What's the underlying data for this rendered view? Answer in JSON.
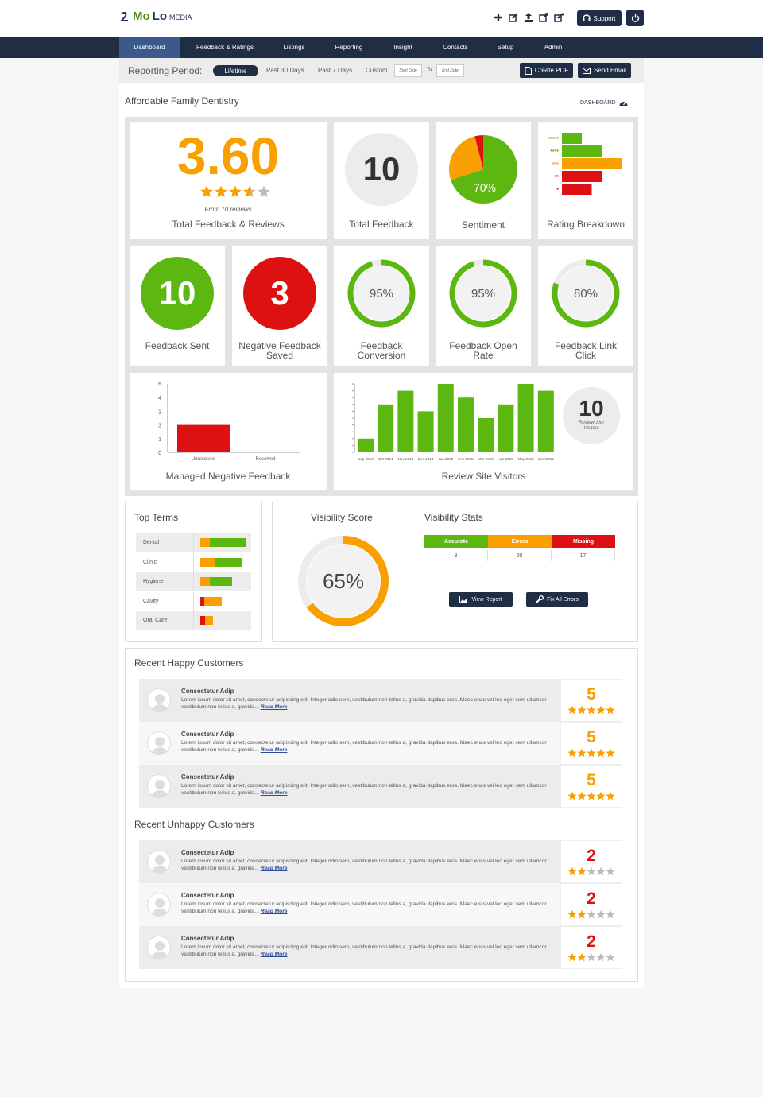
{
  "brand": {
    "mo": "Mo",
    "lo": "Lo",
    "media": "MEDIA"
  },
  "header": {
    "support_label": "Support",
    "icons": [
      "plus-icon",
      "edit-icon",
      "upload-icon",
      "share-icon",
      "external-icon"
    ]
  },
  "nav": {
    "tabs": [
      "Dashboard",
      "Feedback & Ratings",
      "Listings",
      "Reporting",
      "Insight",
      "Contacts",
      "Setup",
      "Admin"
    ],
    "active": "Dashboard"
  },
  "period": {
    "label": "Reporting Period:",
    "selected": "Lifetime",
    "options": [
      "Past 30 Days",
      "Past 7 Days",
      "Custom"
    ],
    "start_placeholder": "Start Date",
    "to": "To",
    "end_placeholder": "End Date",
    "create_pdf": "Create PDF",
    "send_email": "Send Email"
  },
  "business": {
    "name": "Affordable Family Dentistry",
    "dashboard_label": "DASHBOARD"
  },
  "stats": {
    "rating": {
      "value": "3.60",
      "stars": 3.6,
      "sub": "From 10 reviews",
      "caption": "Total Feedback & Reviews"
    },
    "total_feedback": {
      "value": "10",
      "caption": "Total Feedback"
    },
    "sentiment": {
      "value": "70%",
      "caption": "Sentiment",
      "positive": 0.7,
      "negative": 0.04
    },
    "rating_breakdown": {
      "caption": "Rating Breakdown",
      "labels": [
        "*****",
        "****",
        "***",
        "**",
        "*"
      ],
      "values": [
        2,
        4,
        6,
        4,
        3
      ],
      "colors": [
        "#5cb811",
        "#5cb811",
        "#f9a000",
        "#dd1111",
        "#dd1111"
      ]
    },
    "feedback_sent": {
      "value": "10",
      "caption": "Feedback Sent",
      "color": "#5cb811"
    },
    "negative_saved": {
      "value": "3",
      "caption": "Negative Feedback Saved",
      "color": "#dd1111"
    },
    "conversion": {
      "value": "95%",
      "fraction": 0.95,
      "caption": "Feedback Conversion"
    },
    "open_rate": {
      "value": "95%",
      "fraction": 0.95,
      "caption": "Feedback Open Rate"
    },
    "link_click": {
      "value": "80%",
      "fraction": 0.8,
      "caption": "Feedback Link Click"
    },
    "managed_negative": {
      "caption": "Managed Negative Feedback"
    },
    "site_visitors": {
      "caption": "Review Site Visitors",
      "value": "10",
      "sub": "Review Site Visitors"
    }
  },
  "chart_data": [
    {
      "type": "bar",
      "title": "Managed Negative Feedback",
      "categories": [
        "Unresolved",
        "Resolved"
      ],
      "values": [
        2,
        0.05
      ],
      "ytick_labels": [
        "5",
        "4",
        "2",
        "3",
        "1",
        "0"
      ],
      "ylim": [
        0,
        5
      ],
      "colors": [
        "#dd1111",
        "#5cb811"
      ]
    },
    {
      "type": "bar",
      "title": "Review Site Visitors",
      "categories": [
        "Sep 2014",
        "Oct 2014",
        "Nov 2014",
        "Dec 2014",
        "Jan 2015",
        "Feb 2015",
        "Mar 2015",
        "Apr 2015",
        "May 2015",
        "June2015"
      ],
      "values": [
        2,
        7,
        9,
        6,
        10,
        8,
        5,
        7,
        10,
        9
      ],
      "colors": [
        "#5cb811"
      ]
    }
  ],
  "top_terms": {
    "title": "Top Terms",
    "items": [
      {
        "name": "Dental",
        "orange": 12,
        "green": 45
      },
      {
        "name": "Clinic",
        "orange": 18,
        "green": 34
      },
      {
        "name": "Hygiene",
        "orange": 12,
        "green": 28
      },
      {
        "name": "Cavity",
        "red": 5,
        "orange": 22
      },
      {
        "name": "Oral Care",
        "red": 6,
        "orange": 10
      }
    ]
  },
  "visibility": {
    "score_title": "Visibility Score",
    "score": "65%",
    "fraction": 0.65,
    "stats_title": "Visibility Stats",
    "headers": [
      "Accurate",
      "Errors",
      "Missing"
    ],
    "values": [
      "3",
      "20",
      "17"
    ],
    "header_colors": [
      "#5cb811",
      "#f9a000",
      "#dd1111"
    ],
    "view_report": "View Report",
    "fix_errors": "Fix All Errors"
  },
  "happy": {
    "title": "Recent Happy Customers",
    "items": [
      {
        "name": "Consectetur Adip",
        "text": "Lorem ipsum dolor sit amet, consectetur adipiscing elit. Integer odio sem, vestibulum non tellus a, gravida dapibus eros. Maec enas vel leo eget sem ullamcor vestibulum non tellus a, gravida...",
        "more": "Read More",
        "score": "5",
        "stars": 5
      },
      {
        "name": "Consectetur Adip",
        "text": "Lorem ipsum dolor sit amet, consectetur adipiscing elit. Integer odio sem, vestibulum non tellus a, gravida dapibus eros. Maec enas vel leo eget sem ullamcor vestibulum non tellus a, gravida...",
        "more": "Read More",
        "score": "5",
        "stars": 5
      },
      {
        "name": "Consectetur Adip",
        "text": "Lorem ipsum dolor sit amet, consectetur adipiscing elit. Integer odio sem, vestibulum non tellus a, gravida dapibus eros. Maec enas vel leo eget sem ullamcor vestibulum non tellus a, gravida...",
        "more": "Read More",
        "score": "5",
        "stars": 5
      }
    ]
  },
  "unhappy": {
    "title": "Recent Unhappy Customers",
    "items": [
      {
        "name": "Consectetur Adip",
        "text": "Lorem ipsum dolor sit amet, consectetur adipiscing elit. Integer odio sem, vestibulum non tellus a, gravida dapibus eros. Maec enas vel leo eget sem ullamcor vestibulum non tellus a, gravida...",
        "more": "Read More",
        "score": "2",
        "stars": 2
      },
      {
        "name": "Consectetur Adip",
        "text": "Lorem ipsum dolor sit amet, consectetur adipiscing elit. Integer odio sem, vestibulum non tellus a, gravida dapibus eros. Maec enas vel leo eget sem ullamcor vestibulum non tellus a, gravida...",
        "more": "Read More",
        "score": "2",
        "stars": 2
      },
      {
        "name": "Consectetur Adip",
        "text": "Lorem ipsum dolor sit amet, consectetur adipiscing elit. Integer odio sem, vestibulum non tellus a, gravida dapibus eros. Maec enas vel leo eget sem ullamcor vestibulum non tellus a, gravida...",
        "more": "Read More",
        "score": "2",
        "stars": 2
      }
    ]
  },
  "colors": {
    "navy": "#1f2d45",
    "green": "#5cb811",
    "orange": "#f9a000",
    "red": "#dd1111",
    "gray": "#ececec"
  }
}
